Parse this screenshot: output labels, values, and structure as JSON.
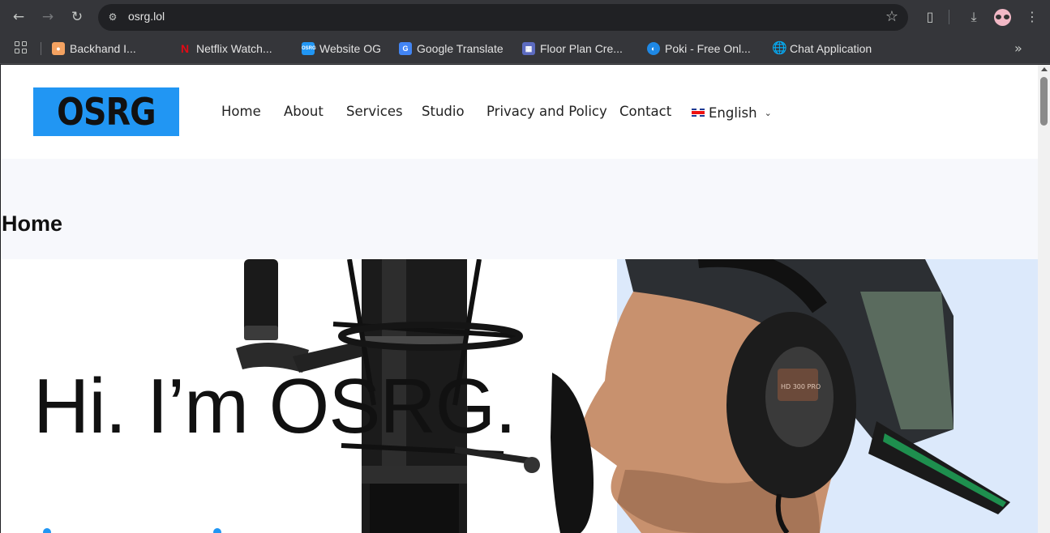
{
  "browser": {
    "url": "osrg.lol",
    "bookmarks": [
      {
        "label": "Backhand I...",
        "icon": "ice-cream-icon",
        "color": "#f4a261"
      },
      {
        "label": "Netflix Watch...",
        "icon": "netflix-icon",
        "color": "#e50914"
      },
      {
        "label": "Website OG",
        "icon": "osrg-icon",
        "color": "#2196f3"
      },
      {
        "label": "Google Translate",
        "icon": "google-translate-icon",
        "color": "#4285f4"
      },
      {
        "label": "Floor Plan Cre...",
        "icon": "floor-plan-icon",
        "color": "#5c6bc0"
      },
      {
        "label": "Poki - Free Onl...",
        "icon": "poki-icon",
        "color": "#1e88e5"
      },
      {
        "label": "Chat Application",
        "icon": "globe-icon",
        "color": "#c4c7c5"
      }
    ]
  },
  "site": {
    "logo_text": "OSRG",
    "brand_color": "#2196f3",
    "nav": {
      "home": "Home",
      "about": "About",
      "services": "Services",
      "studio": "Studio",
      "privacy": "Privacy and Policy",
      "contact": "Contact",
      "language": "English"
    },
    "page_title": "Home",
    "hero": {
      "heading": "Hi. I’m OSRG."
    }
  }
}
